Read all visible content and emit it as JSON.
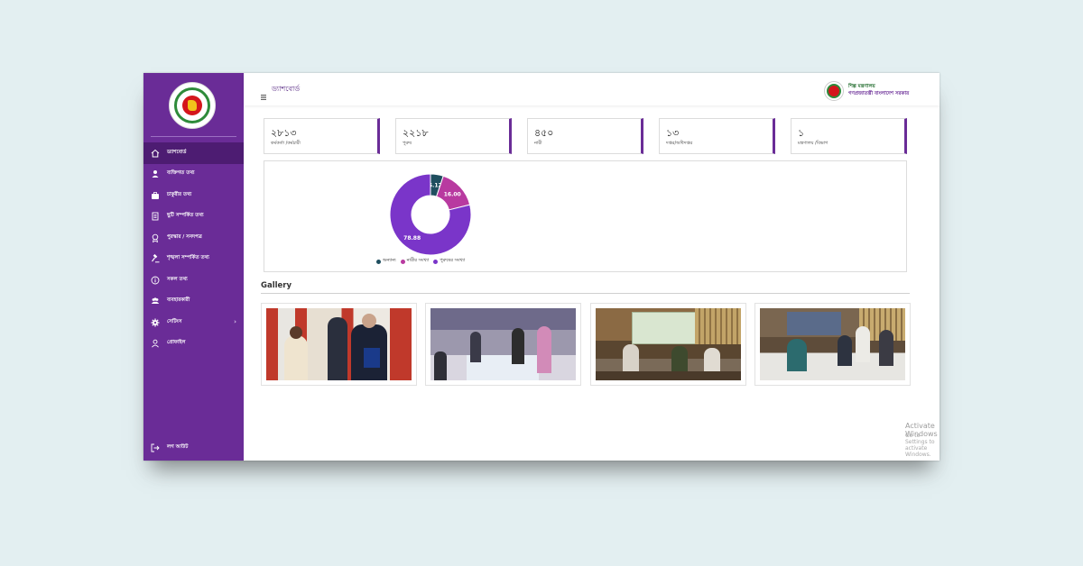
{
  "sidebar": {
    "logo": "government-seal-logo",
    "items": [
      {
        "label": "ড্যাশবোর্ড",
        "icon": "home-icon",
        "active": true
      },
      {
        "label": "ব্যক্তিগত তথ্য",
        "icon": "person-icon"
      },
      {
        "label": "চাকুরীর তথ্য",
        "icon": "briefcase-icon"
      },
      {
        "label": "ছুটি সম্পর্কিত তথ্য",
        "icon": "document-icon"
      },
      {
        "label": "পুরস্কার / সনদপত্র",
        "icon": "award-icon"
      },
      {
        "label": "শৃঙ্খলা সম্পর্কিত তথ্য",
        "icon": "gavel-icon"
      },
      {
        "label": "সকল তথ্য",
        "icon": "info-icon"
      },
      {
        "label": "ব্যবহারকারী",
        "icon": "users-icon"
      },
      {
        "label": "সেটিংস",
        "icon": "gear-icon",
        "has_submenu": true
      },
      {
        "label": "প্রোফাইল",
        "icon": "profile-icon"
      }
    ],
    "logout": {
      "label": "লগ আউট",
      "icon": "logout-icon"
    }
  },
  "header": {
    "title": "ড্যাশবোর্ড",
    "org_line1": "শিল্প মন্ত্রণালয়",
    "org_line2": "গণপ্রজাতন্ত্রী বাংলাদেশ সরকার"
  },
  "stats": [
    {
      "value": "২৮১৩",
      "label": "কর্মকর্তা /কর্মচারী"
    },
    {
      "value": "২২১৮",
      "label": "পুরুষ"
    },
    {
      "value": "৪৫০",
      "label": "নারী"
    },
    {
      "value": "১৩",
      "label": "দপ্তর/অধিদপ্তর"
    },
    {
      "value": "১",
      "label": "মন্ত্রণালয় /বিভাগ"
    }
  ],
  "chart_data": {
    "type": "pie",
    "donut": true,
    "labels": [
      "অন্যান্য",
      "নারীর সংখ্যা",
      "পুরুষের সংখ্যা"
    ],
    "values": [
      5.12,
      16.0,
      78.88
    ],
    "value_labels": [
      "5.12",
      "16.00",
      "78.88"
    ],
    "colors": [
      "#1f4e5f",
      "#b83aa0",
      "#7a35c9"
    ],
    "legend_position": "bottom"
  },
  "gallery": {
    "title": "Gallery",
    "photos": [
      "signing-ceremony-photo",
      "award-event-photo",
      "ministry-meeting-photo",
      "agreement-signing-photo"
    ]
  },
  "watermark": {
    "line1": "Activate Windows",
    "line2": "Go to Settings to activate Windows."
  }
}
